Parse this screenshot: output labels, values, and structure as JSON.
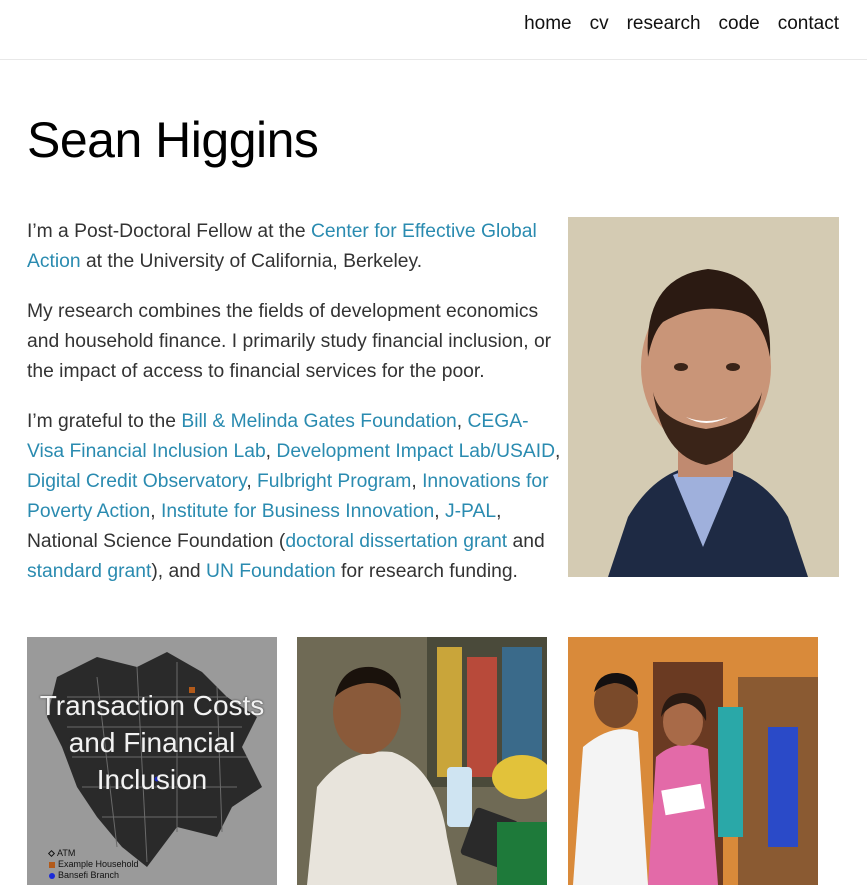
{
  "nav": {
    "items": [
      "home",
      "cv",
      "research",
      "code",
      "contact"
    ]
  },
  "header": {
    "name": "Sean Higgins"
  },
  "bio": {
    "p1": {
      "t1": "I’m a Post-Doctoral Fellow at the ",
      "link1": "Center for Effective Global Action",
      "t2": " at the University of California, Berkeley."
    },
    "p2": "My research combines the fields of development economics and household finance. I primarily study financial inclusion, or the impact of access to financial services for the poor.",
    "p3": {
      "t1": "I’m grateful to the ",
      "l1": "Bill & Melinda Gates Foundation",
      "s1": ", ",
      "l2": "CEGA-Visa Financial Inclusion Lab",
      "s2": ", ",
      "l3": "Development Impact Lab/USAID",
      "s3": ", ",
      "l4": "Digital Credit Observatory",
      "s4": ", ",
      "l5": "Fulbright Program",
      "s5": ", ",
      "l6": "Innovations for Poverty Action",
      "s6": ", ",
      "l7": "Institute for Business Innovation",
      "s7": ", ",
      "l8": "J-PAL",
      "s8": ", National Science Foundation (",
      "l9": "doctoral dissertation grant",
      "s9": " and ",
      "l10": "standard grant",
      "s10": "), and ",
      "l11": "UN Foundation",
      "s11": " for research funding."
    }
  },
  "thumbnails": {
    "t1": {
      "caption": "Transaction Costs and Financial Inclusion",
      "legend": [
        "ATM",
        "Example Household",
        "Bansefi Branch"
      ]
    }
  },
  "colors": {
    "link": "#2a8bb0",
    "text": "#333333",
    "title": "#000000"
  }
}
